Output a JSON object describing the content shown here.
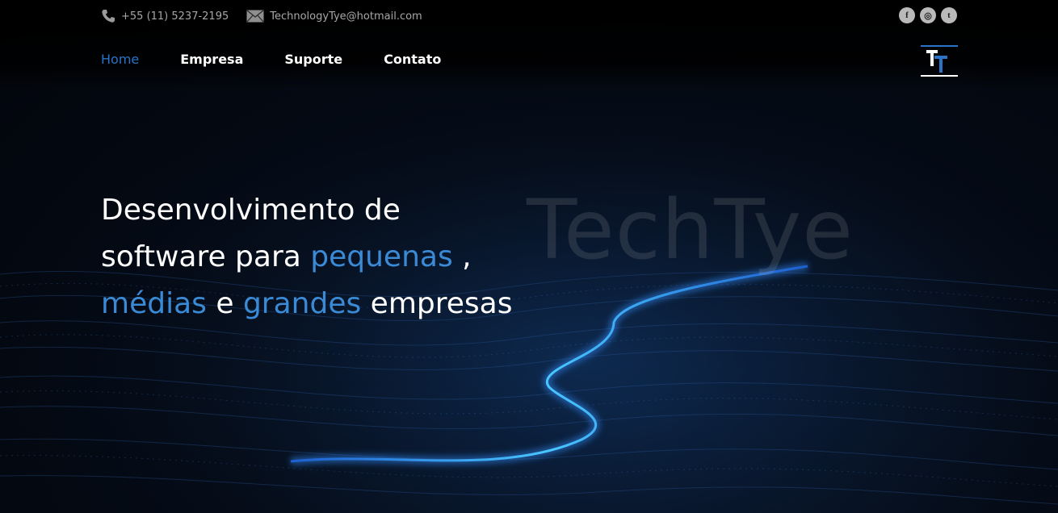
{
  "topbar": {
    "phone": "+55 (11) 5237-2195",
    "email": "TechnologyTye@hotmail.com",
    "icons": [
      "phone-icon",
      "mail-icon"
    ]
  },
  "social": {
    "facebook": "f",
    "instagram": "◎",
    "twitter": "t"
  },
  "nav": {
    "items": [
      {
        "label": "Home",
        "active": true
      },
      {
        "label": "Empresa",
        "active": false
      },
      {
        "label": "Suporte",
        "active": false
      },
      {
        "label": "Contato",
        "active": false
      }
    ]
  },
  "logo": {
    "text": "TT"
  },
  "hero": {
    "line1": "Desenvolvimento de",
    "line2_a": "software para ",
    "line2_b": "pequenas",
    "line2_c": " ,",
    "line3_a": "médias",
    "line3_b": " e ",
    "line3_c": "grandes",
    "line3_d": " empresas",
    "watermark": "TechTye"
  },
  "colors": {
    "accent": "#2a73c9",
    "highlight": "#3a8ad6",
    "background": "#03070f"
  }
}
